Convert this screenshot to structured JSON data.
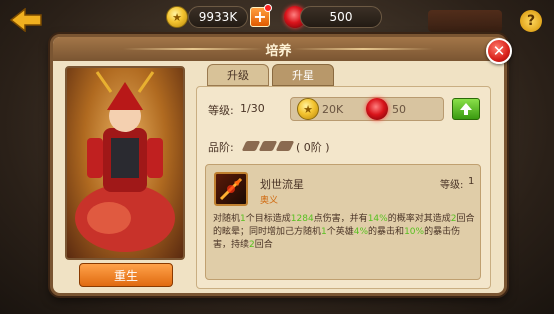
{
  "top_bar": {
    "gold": "9933K",
    "gems": "500",
    "plus_label": "+",
    "help_label": "?"
  },
  "dialog": {
    "title": "培养",
    "close_label": "✕"
  },
  "hero": {
    "rebirth_label": "重生"
  },
  "tabs": [
    {
      "label": "升级",
      "active": true
    },
    {
      "label": "升星",
      "active": false
    }
  ],
  "level": {
    "label": "等级:",
    "value": "1/30",
    "cost_gold": "20K",
    "cost_gem": "50"
  },
  "rank": {
    "label": "品阶:",
    "value": "( 0阶 )"
  },
  "skill": {
    "name": "划世流星",
    "type": "奥义",
    "level_label": "等级:",
    "level_value": "1",
    "desc": {
      "p1": "对随机",
      "n1": "1",
      "p2": "个目标造成",
      "n2": "1284",
      "p3": "点伤害，并有",
      "n3": "14%",
      "p4": "的概率对其造成",
      "n4": "2",
      "p5": "回合的眩晕；同时增加己方随机",
      "n5": "1",
      "p6": "个英雄",
      "n6": "4%",
      "p7": "的暴击和",
      "n7": "10%",
      "p8": "的暴击伤害，持续",
      "n8": "2",
      "p9": "回合"
    }
  },
  "colors": {
    "accent_orange": "#e06a10",
    "highlight_green": "#58c020",
    "gem_red": "#d9141b",
    "panel_bg": "#f0e2c4"
  }
}
